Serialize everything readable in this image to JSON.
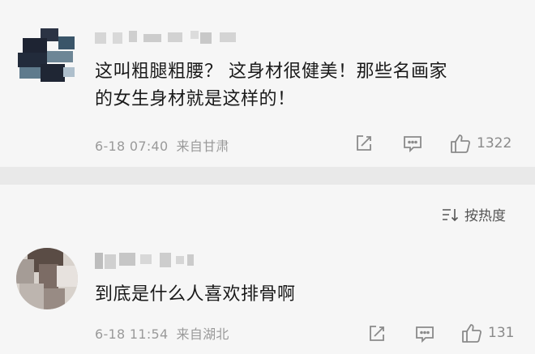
{
  "comments": [
    {
      "text_line1": "这叫粗腿粗腰？ 这身材很健美！那些名画家",
      "text_line2": "的女生身材就是这样的！",
      "date": "6-18 07:40",
      "location": "来自甘肃",
      "likes": "1322"
    },
    {
      "text_line1": "到底是什么人喜欢排骨啊",
      "date": "6-18 11:54",
      "location": "来自湖北",
      "likes": "131"
    }
  ],
  "sort": {
    "label": "按热度"
  },
  "colors": {
    "meta": "#9a9a9a",
    "icon": "#8a8a8a",
    "text": "#1a1a1a"
  }
}
